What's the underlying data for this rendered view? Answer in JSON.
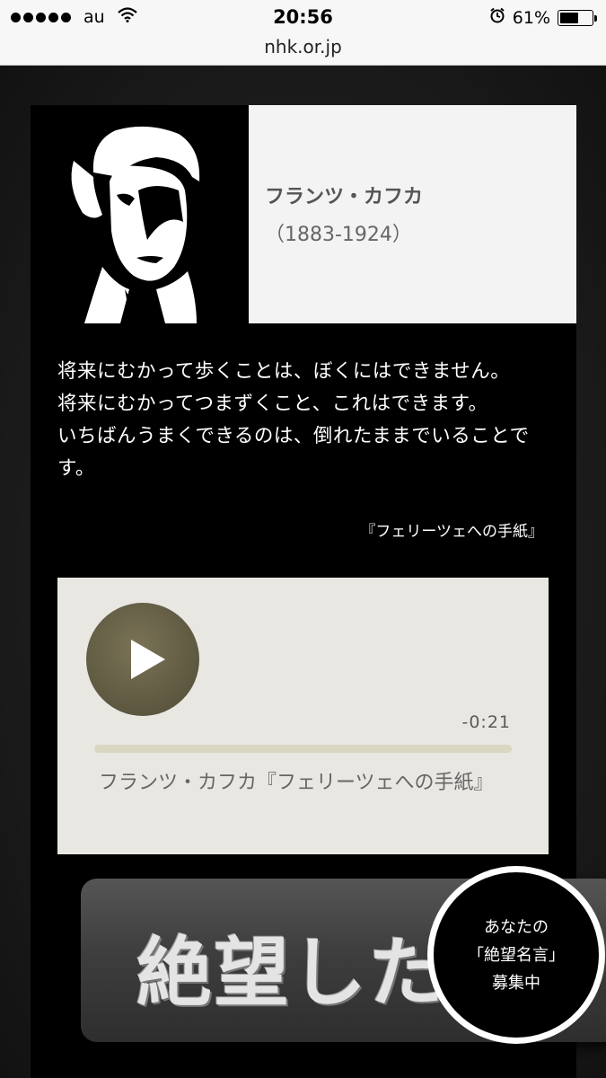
{
  "status_bar": {
    "carrier": "au",
    "time": "20:56",
    "battery_percent": "61%",
    "battery_level": 0.61
  },
  "url_bar": {
    "domain": "nhk.or.jp"
  },
  "author": {
    "name": "フランツ・カフカ",
    "years": "（1883-1924）"
  },
  "quote": {
    "lines": [
      "将来にむかって歩くことは、ぼくにはできません。",
      "将来にむかってつまずくこと、これはできます。",
      "いちばんうまくできるのは、倒れたままでいることです。"
    ],
    "source": "『フェリーツェへの手紙』"
  },
  "player": {
    "remaining": "-0:21",
    "progress": 0.0,
    "title": "フランツ・カフカ『フェリーツェへの手紙』"
  },
  "banner": {
    "text": "絶望した"
  },
  "recruit": {
    "line1": "あなたの",
    "line2": "「絶望名言」",
    "line3": "募集中"
  },
  "colors": {
    "panel": "#000000",
    "name_box": "#f3f3f3",
    "player_bg": "#e9e7e2",
    "play_button": "#615b43",
    "progress_track": "#d9d6c2"
  },
  "icons": [
    "signal-dots-icon",
    "wifi-icon",
    "alarm-icon",
    "battery-icon",
    "play-icon"
  ]
}
